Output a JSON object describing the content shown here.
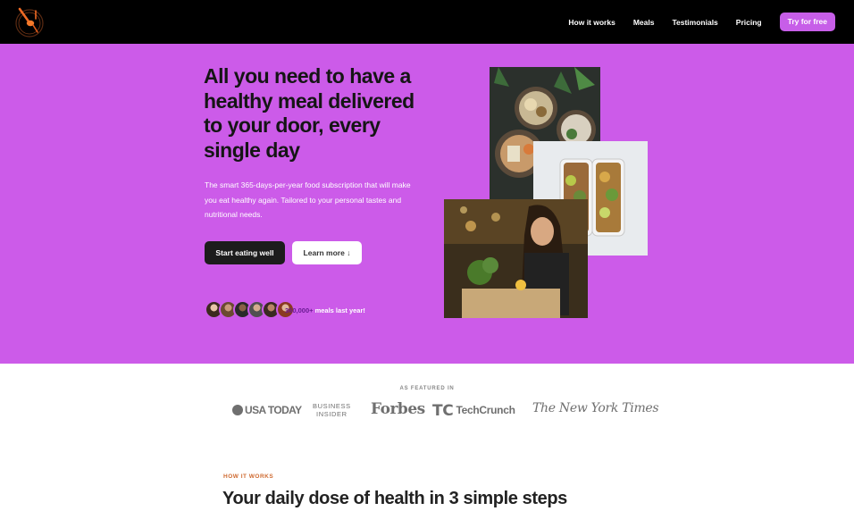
{
  "nav": {
    "links": [
      "How it works",
      "Meals",
      "Testimonials",
      "Pricing"
    ],
    "cta": "Try for free"
  },
  "hero": {
    "title": "All you need to have a healthy meal delivered to your door, every single day",
    "description": "The smart 365-days-per-year food subscription that will make you eat healthy again. Tailored to your personal tastes and nutritional needs.",
    "primary_button": "Start eating well",
    "secondary_button": "Learn more ↓",
    "social_proof": {
      "count": "360,000+",
      "text": " meals last year!"
    }
  },
  "featured": {
    "label": "AS FEATURED IN",
    "publications": {
      "usa_today": "USA TODAY",
      "business_insider_line1": "BUSINESS",
      "business_insider_line2": "INSIDER",
      "forbes": "Forbes",
      "techcrunch_mark": "TC",
      "techcrunch": "TechCrunch",
      "nyt": "The New York Times"
    }
  },
  "how_it_works": {
    "label": "HOW IT WORKS",
    "heading": "Your daily dose of health in 3 simple steps"
  },
  "colors": {
    "hero_bg": "#cc5be9",
    "accent_cta": "#c75ee8",
    "nav_bg": "#000000",
    "section_label": "#cf6b32"
  }
}
